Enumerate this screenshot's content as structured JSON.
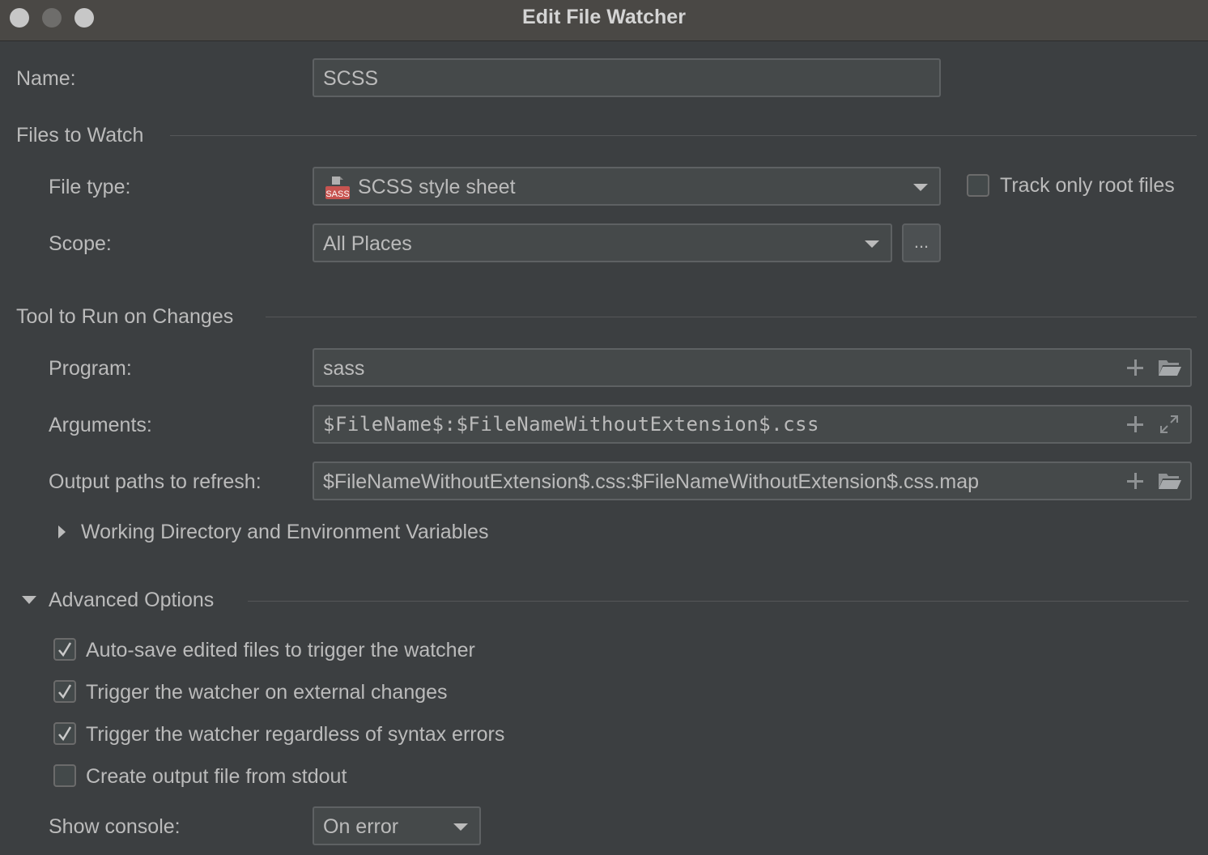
{
  "window": {
    "title": "Edit File Watcher"
  },
  "name": {
    "label": "Name:",
    "value": "SCSS"
  },
  "files_to_watch": {
    "title": "Files to Watch",
    "file_type_label": "File type:",
    "file_type_value": "SCSS style sheet",
    "file_type_icon": "sass-file-icon",
    "file_type_icon_text": "SASS",
    "track_root_label": "Track only root files",
    "track_root_checked": false,
    "scope_label": "Scope:",
    "scope_value": "All Places",
    "scope_button": "..."
  },
  "tool": {
    "title": "Tool to Run on Changes",
    "program_label": "Program:",
    "program_value": "sass",
    "arguments_label": "Arguments:",
    "arguments_value": "$FileName$:$FileNameWithoutExtension$.css",
    "output_label": "Output paths to refresh:",
    "output_value": "$FileNameWithoutExtension$.css:$FileNameWithoutExtension$.css.map",
    "working_dir_label": "Working Directory and Environment Variables"
  },
  "advanced": {
    "title": "Advanced Options",
    "options": [
      {
        "label": "Auto-save edited files to trigger the watcher",
        "checked": true
      },
      {
        "label": "Trigger the watcher on external changes",
        "checked": true
      },
      {
        "label": "Trigger the watcher regardless of syntax errors",
        "checked": true
      },
      {
        "label": "Create output file from stdout",
        "checked": false
      }
    ],
    "show_console_label": "Show console:",
    "show_console_value": "On error"
  },
  "colors": {
    "background": "#3c3f41",
    "field": "#45494a",
    "border": "#5e6163",
    "text": "#bbbbbb",
    "sass_icon": "#c6538c"
  }
}
